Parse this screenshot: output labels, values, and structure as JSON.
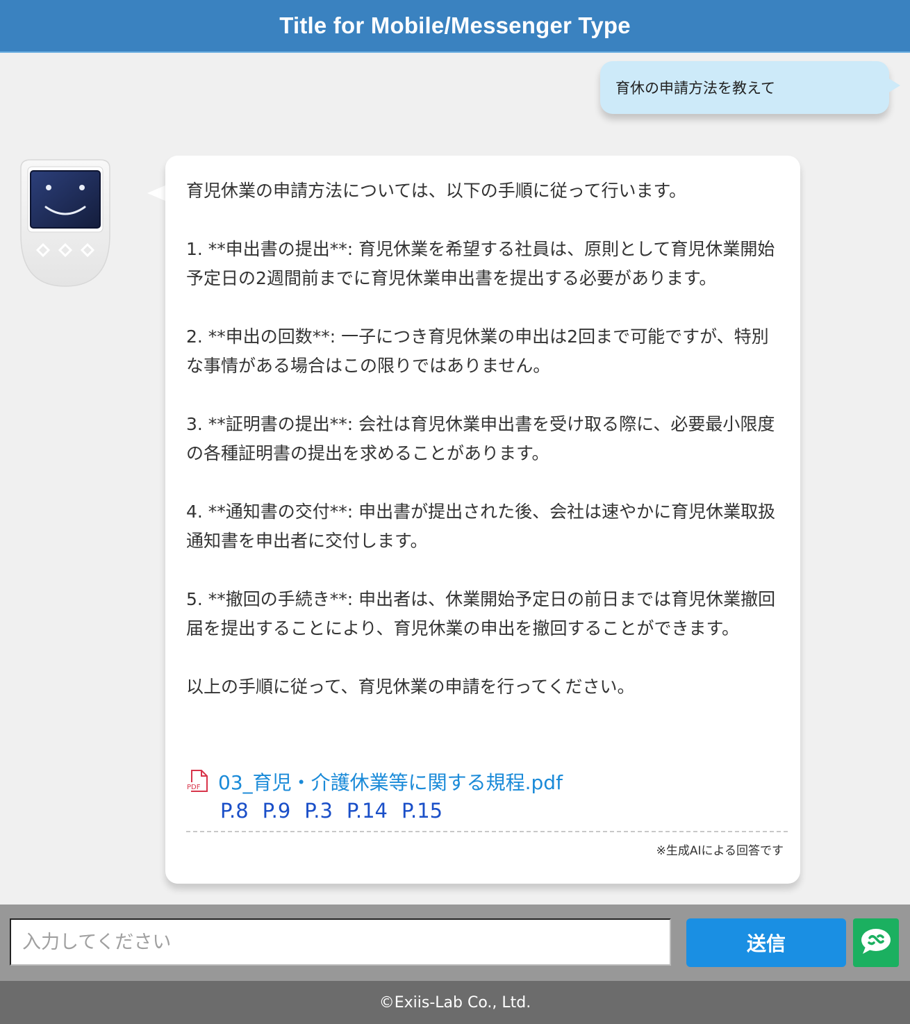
{
  "header": {
    "title": "Title for Mobile/Messenger Type"
  },
  "user_message": {
    "text": "育休の申請方法を教えて"
  },
  "bot_message": {
    "intro": "育児休業の申請方法については、以下の手順に従って行います。",
    "steps": [
      "1. **申出書の提出**: 育児休業を希望する社員は、原則として育児休業開始予定日の2週間前までに育児休業申出書を提出する必要があります。",
      "2. **申出の回数**: 一子につき育児休業の申出は2回まで可能ですが、特別な事情がある場合はこの限りではありません。",
      "3. **証明書の提出**: 会社は育児休業申出書を受け取る際に、必要最小限度の各種証明書の提出を求めることがあります。",
      "4. **通知書の交付**: 申出書が提出された後、会社は速やかに育児休業取扱通知書を申出者に交付します。",
      "5. **撤回の手続き**: 申出者は、休業開始予定日の前日までは育児休業撤回届を提出することにより、育児休業の申出を撤回することができます。"
    ],
    "outro": "以上の手順に従って、育児休業の申請を行ってください。",
    "source": {
      "file_name": "03_育児・介護休業等に関する規程.pdf",
      "pages": [
        "P.8",
        "P.9",
        "P.3",
        "P.14",
        "P.15"
      ]
    },
    "ai_note": "※生成AIによる回答です"
  },
  "input": {
    "placeholder": "入力してください",
    "value": ""
  },
  "send_button": {
    "label": "送信"
  },
  "footer": {
    "copyright": "©Exiis-Lab Co., Ltd."
  },
  "colors": {
    "header_bg": "#3a82c0",
    "user_bubble": "#cdeaf9",
    "send_button": "#1a8fe3",
    "feedback_button": "#1bb060",
    "link": "#1a8ad8",
    "page_link": "#1a4fc8",
    "footer_bg": "#6c6c6c"
  },
  "icons": {
    "avatar": "robot-face-icon",
    "pdf": "pdf-file-icon",
    "feedback": "chat-bubble-icon"
  }
}
